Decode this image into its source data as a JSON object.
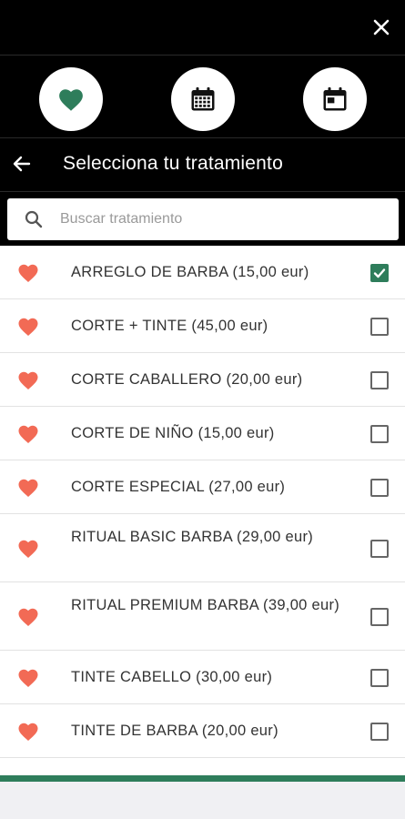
{
  "header": {
    "close_icon": "close-icon",
    "title": "Selecciona tu tratamiento",
    "back_icon": "arrow-left-icon"
  },
  "quick_actions": [
    {
      "icon": "heart-icon",
      "color": "#2e7d5b"
    },
    {
      "icon": "calendar-grid-icon"
    },
    {
      "icon": "calendar-day-icon"
    }
  ],
  "search": {
    "placeholder": "Buscar tratamiento",
    "value": ""
  },
  "treatments": [
    {
      "label": "ARREGLO DE BARBA (15,00 eur)",
      "favorite": true,
      "checked": true
    },
    {
      "label": "CORTE + TINTE (45,00 eur)",
      "favorite": true,
      "checked": false
    },
    {
      "label": "CORTE CABALLERO (20,00 eur)",
      "favorite": true,
      "checked": false
    },
    {
      "label": "CORTE DE NIÑO (15,00 eur)",
      "favorite": true,
      "checked": false
    },
    {
      "label": "CORTE ESPECIAL (27,00 eur)",
      "favorite": true,
      "checked": false
    },
    {
      "label": "RITUAL BASIC BARBA (29,00 eur)",
      "favorite": true,
      "checked": false
    },
    {
      "label": "RITUAL PREMIUM BARBA (39,00 eur)",
      "favorite": true,
      "checked": false
    },
    {
      "label": "TINTE CABELLO (30,00 eur)",
      "favorite": true,
      "checked": false
    },
    {
      "label": "TINTE DE BARBA (20,00 eur)",
      "favorite": true,
      "checked": false
    }
  ],
  "colors": {
    "accent": "#2e7d5b",
    "heart": "#f26a55"
  }
}
